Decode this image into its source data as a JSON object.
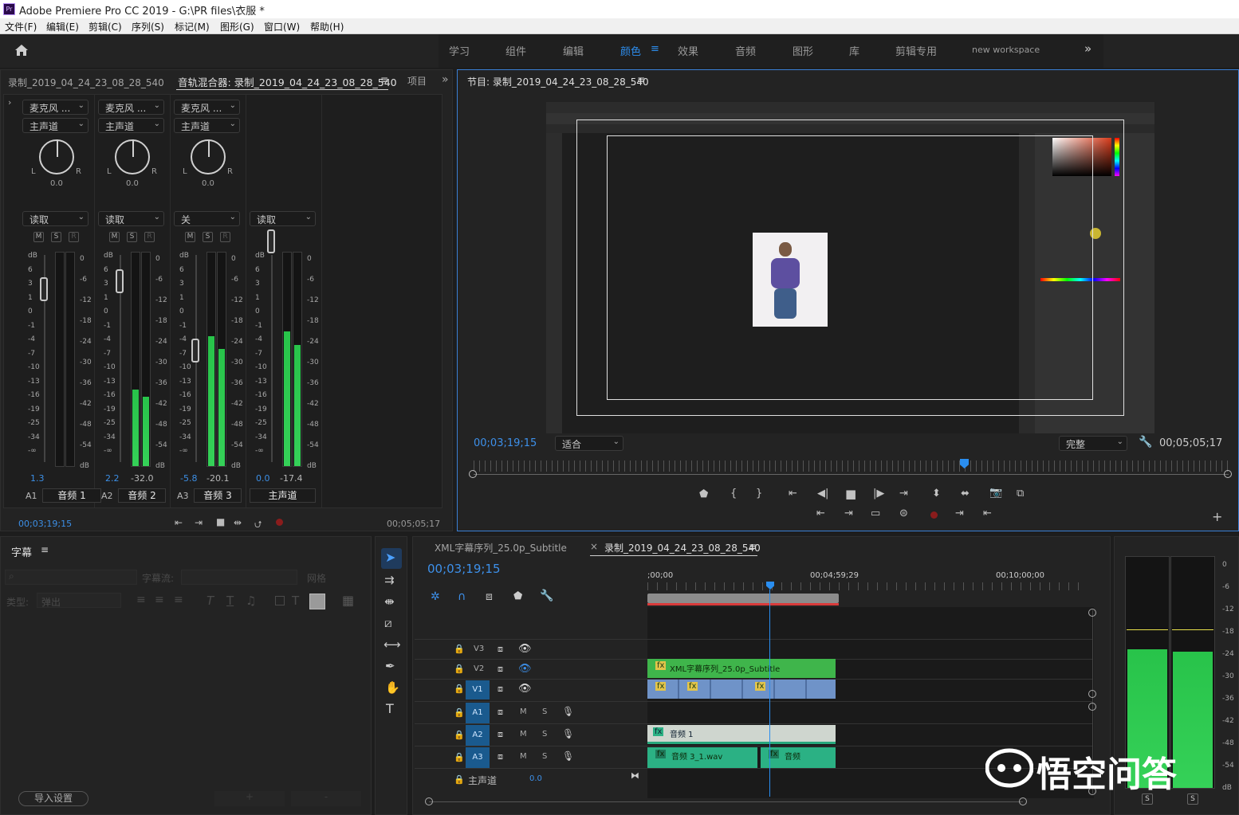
{
  "app": {
    "title": "Adobe Premiere Pro CC 2019 - G:\\PR files\\衣服 *",
    "icon": "Pr"
  },
  "menu": [
    "文件(F)",
    "编辑(E)",
    "剪辑(C)",
    "序列(S)",
    "标记(M)",
    "图形(G)",
    "窗口(W)",
    "帮助(H)"
  ],
  "workspaces": [
    "学习",
    "组件",
    "编辑",
    "颜色",
    "效果",
    "音频",
    "图形",
    "库",
    "剪辑专用",
    "new workspace"
  ],
  "active_workspace": "颜色",
  "mixer": {
    "tab_left": "录制_2019_04_24_23_08_28_540",
    "tab_active": "音轨混合器: 录制_2019_04_24_23_08_28_540",
    "tab_right": "项目",
    "channels": [
      {
        "input": "麦克风 ...",
        "output": "主声道",
        "pan": "0.0",
        "auto": "读取",
        "vol": "1.3",
        "peak": "",
        "id": "A1",
        "name": "音频 1",
        "level": 0.0
      },
      {
        "input": "麦克风 ...",
        "output": "主声道",
        "pan": "0.0",
        "auto": "读取",
        "vol": "2.2",
        "peak": "-32.0",
        "id": "A2",
        "name": "音频 2",
        "level": 0.36
      },
      {
        "input": "麦克风 ...",
        "output": "主声道",
        "pan": "0.0",
        "auto": "关",
        "vol": "-5.8",
        "peak": "-20.1",
        "id": "A3",
        "name": "音频 3",
        "level": 0.61
      },
      {
        "input": "",
        "output": "",
        "pan": "",
        "auto": "读取",
        "vol": "0.0",
        "peak": "-17.4",
        "id": "",
        "name": "主声道",
        "level": 0.63
      }
    ],
    "left_scale": [
      "dB",
      "6",
      "3",
      "1",
      "0",
      "-1",
      "-4",
      "-7",
      "-10",
      "-13",
      "-16",
      "-19",
      "-25",
      "-34",
      "-∞"
    ],
    "right_scale": [
      "0",
      "-6",
      "-12",
      "-18",
      "-24",
      "-30",
      "-36",
      "-42",
      "-48",
      "-54",
      "dB"
    ],
    "mute": "M",
    "solo": "S",
    "rec": "R",
    "L": "L",
    "R": "R",
    "timecode_left": "00;03;19;15",
    "timecode_right": "00;05;05;17"
  },
  "program": {
    "title": "节目: 录制_2019_04_24_23_08_28_540",
    "timecode": "00;03;19;15",
    "fit": "适合",
    "quality": "完整",
    "duration": "00;05;05;17"
  },
  "captions": {
    "title": "字幕",
    "stream_label": "字幕流:",
    "type_label": "类型:",
    "type_value": "弹出",
    "grid_label": "网格",
    "import_btn": "导入设置",
    "plus": "+",
    "minus": "-"
  },
  "timeline": {
    "tab1": "XML字幕序列_25.0p_Subtitle",
    "tab2": "录制_2019_04_24_23_08_28_540",
    "timecode": "00;03;19;15",
    "ruler": [
      ";00;00",
      "00;04;59;29",
      "00;10;00;00"
    ],
    "video_tracks": [
      "V3",
      "V2",
      "V1"
    ],
    "audio_tracks": [
      "A1",
      "A2",
      "A3"
    ],
    "master": "主声道",
    "master_val": "0.0",
    "clip_v2": "XML字幕序列_25.0p_Subtitle",
    "clip_a2": "音频 1",
    "clip_a3a": "音频 3_1.wav",
    "clip_a3b": "音频"
  },
  "meters_right": {
    "scale": [
      "0",
      "-6",
      "-12",
      "-18",
      "-24",
      "-30",
      "-36",
      "-42",
      "-48",
      "-54",
      "dB"
    ],
    "solo": "S",
    "levels": [
      0.6,
      0.59
    ]
  },
  "watermark": "悟空问答"
}
